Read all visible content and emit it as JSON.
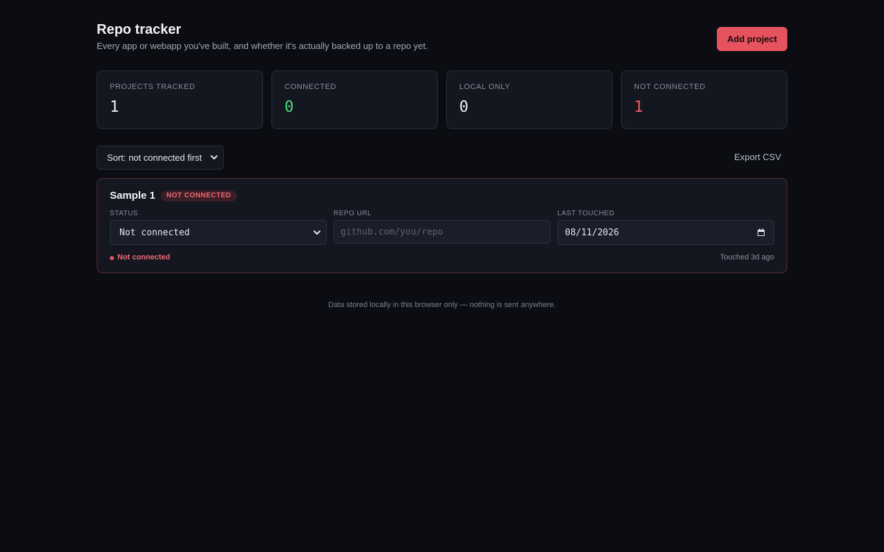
{
  "header": {
    "title": "Repo tracker",
    "subtitle": "Every app or webapp you've built, and whether it's actually backed up to a repo yet.",
    "add_button": "Add project"
  },
  "stats": [
    {
      "label": "PROJECTS TRACKED",
      "value": "1",
      "color": "#eef0f4"
    },
    {
      "label": "CONNECTED",
      "value": "0",
      "color": "#4ade80"
    },
    {
      "label": "LOCAL ONLY",
      "value": "0",
      "color": "#eef0f4"
    },
    {
      "label": "NOT CONNECTED",
      "value": "1",
      "color": "#ef5b66"
    }
  ],
  "toolbar": {
    "sort_value": "Sort: not connected first",
    "export_label": "Export CSV"
  },
  "projects": [
    {
      "name": "Sample 1",
      "badge": "NOT CONNECTED",
      "status_label": "STATUS",
      "status_value": "Not connected",
      "repo_label": "REPO URL",
      "repo_placeholder": "github.com/you/repo",
      "repo_value": "",
      "date_label": "LAST TOUCHED",
      "date_value": "08/11/2026",
      "indicator": "Not connected",
      "touched": "Touched 3d ago"
    }
  ],
  "footer": "Data stored locally in this browser only — nothing is sent anywhere.",
  "colors": {
    "background": "#0b0d13",
    "accent": "#e5535e",
    "connected": "#4ade80",
    "not_connected": "#ef5b66"
  },
  "icons": {
    "sort": "chevron-down-icon",
    "status": "chevron-down-icon",
    "date": "calendar-icon",
    "indicator": "status-dot-icon"
  }
}
